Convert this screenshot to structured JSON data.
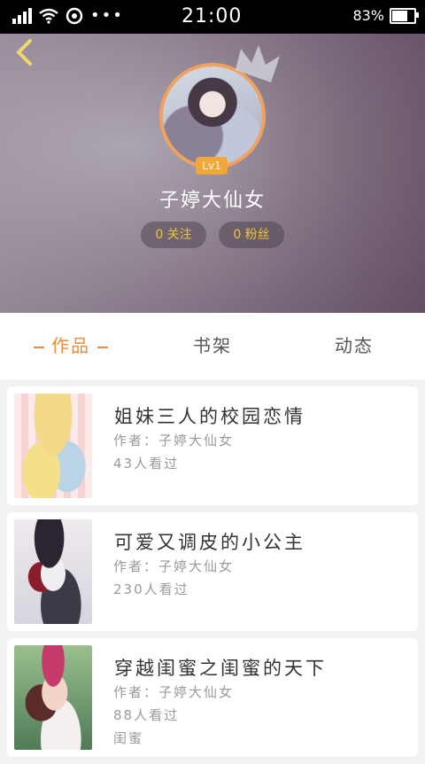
{
  "status_bar": {
    "time": "21:00",
    "battery": "83%",
    "battery_level": 0.83,
    "icons": [
      "signal-icon",
      "wifi-icon",
      "sync-icon",
      "more-dots-icon",
      "battery-icon"
    ]
  },
  "header": {
    "back_icon": "chevron-left-icon",
    "level": "Lv1",
    "username": "子婷大仙女",
    "following": "0 关注",
    "followers": "0 粉丝",
    "colors": {
      "accent": "#f08a3d",
      "pill_text": "#f1c33a",
      "badge": "#f2a838"
    }
  },
  "tabs": {
    "works": "作品",
    "bookshelf": "书架",
    "activity": "动态",
    "active": "works"
  },
  "books": [
    {
      "title": "姐妹三人的校园恋情",
      "author": "作者：子婷大仙女",
      "views": "43人看过",
      "tag": ""
    },
    {
      "title": "可爱又调皮的小公主",
      "author": "作者：子婷大仙女",
      "views": "230人看过",
      "tag": ""
    },
    {
      "title": "穿越闺蜜之闺蜜的天下",
      "author": "作者：子婷大仙女",
      "views": "88人看过",
      "tag": "闺蜜"
    }
  ]
}
